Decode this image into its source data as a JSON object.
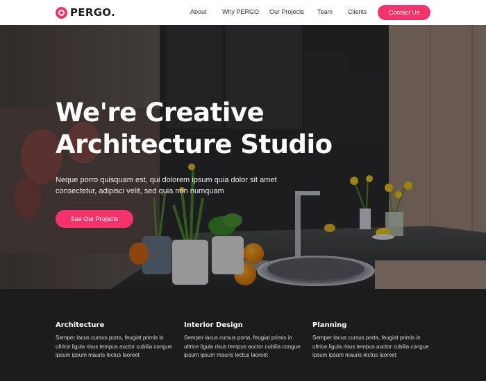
{
  "brand": {
    "name": "PERGO.",
    "accent": "#f5336b"
  },
  "nav": {
    "links": [
      "About",
      "Why PERGO",
      "Our Projects",
      "Team",
      "Clients"
    ],
    "cta": "Contact Us"
  },
  "hero": {
    "title_line1": "We're Creative",
    "title_line2": "Architecture Studio",
    "subtitle": "Neque porro quisquam est, qui dolorem ipsum quia dolor sit amet consectetur, adipisci velit, sed quia non numquam",
    "button": "See Our Projects"
  },
  "features": [
    {
      "title": "Architecture",
      "text": "Semper lacus cursus porta, feugiat primis in ultrice ligula risus tempus auctor cubilia congue ipsum ipsum mauris lectus laoreet"
    },
    {
      "title": "Interior Design",
      "text": "Semper lacus cursus porta, feugiat primis in ultrice ligula risus tempus auctor cubilia congue ipsum ipsum mauris lectus laoreet"
    },
    {
      "title": "Planning",
      "text": "Semper lacus cursus porta, feugiat primis in ultrice ligula risus tempus auctor cubilia congue ipsum ipsum mauris lectus laoreet"
    }
  ]
}
